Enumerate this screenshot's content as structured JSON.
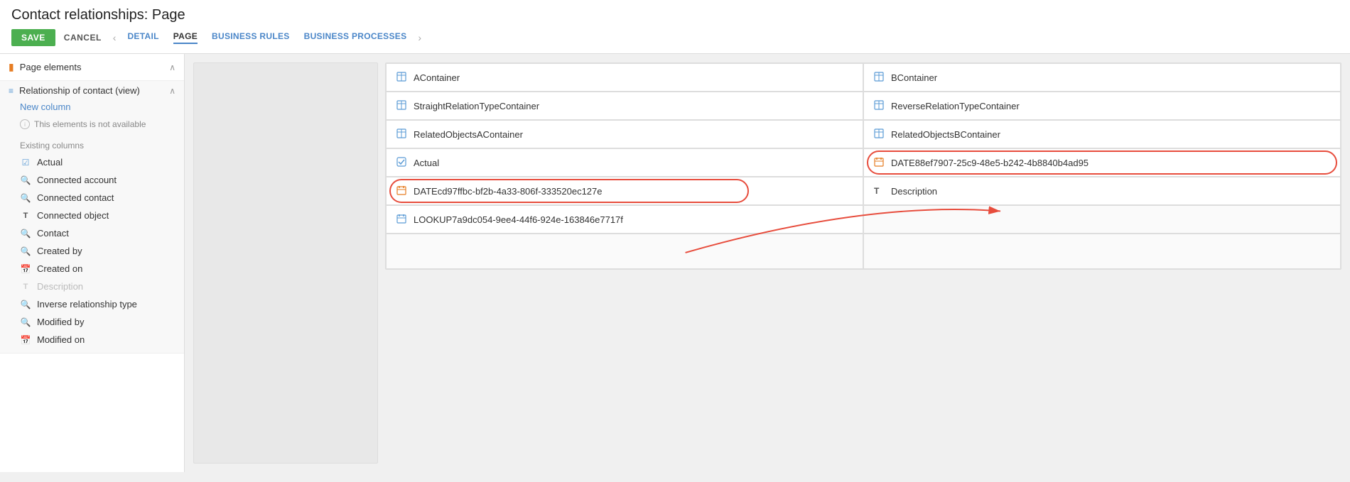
{
  "page": {
    "title": "Contact relationships: Page",
    "toolbar": {
      "save_label": "SAVE",
      "cancel_label": "CANCEL"
    },
    "nav": {
      "prev_arrow": "‹",
      "next_arrow": "›",
      "tabs": [
        {
          "label": "DETAIL",
          "active": false
        },
        {
          "label": "PAGE",
          "active": true
        },
        {
          "label": "BUSINESS RULES",
          "active": false
        },
        {
          "label": "BUSINESS PROCESSES",
          "active": false
        }
      ]
    }
  },
  "sidebar": {
    "section_title": "Page elements",
    "subsection_title": "Relationship of contact (view)",
    "new_column": "New column",
    "unavailable_text": "This elements is not available",
    "existing_columns_label": "Existing columns",
    "items": [
      {
        "label": "Actual",
        "icon": "check",
        "disabled": false
      },
      {
        "label": "Connected account",
        "icon": "search",
        "disabled": false
      },
      {
        "label": "Connected contact",
        "icon": "search",
        "disabled": false
      },
      {
        "label": "Connected object",
        "icon": "text",
        "disabled": false
      },
      {
        "label": "Contact",
        "icon": "search",
        "disabled": false
      },
      {
        "label": "Created by",
        "icon": "search",
        "disabled": false
      },
      {
        "label": "Created on",
        "icon": "calendar",
        "disabled": false
      },
      {
        "label": "Description",
        "icon": "text",
        "disabled": true
      },
      {
        "label": "Inverse relationship type",
        "icon": "search",
        "disabled": false
      },
      {
        "label": "Modified by",
        "icon": "search",
        "disabled": false
      },
      {
        "label": "Modified on",
        "icon": "calendar",
        "disabled": false
      }
    ]
  },
  "grid": {
    "cells": [
      [
        {
          "icon": "table",
          "label": "AContainer",
          "col": 0,
          "row": 0,
          "annotated": false
        },
        {
          "icon": "table",
          "label": "BContainer",
          "col": 1,
          "row": 0,
          "annotated": false
        }
      ],
      [
        {
          "icon": "table",
          "label": "StraightRelationTypeContainer",
          "col": 0,
          "row": 1,
          "annotated": false
        },
        {
          "icon": "table",
          "label": "ReverseRelationTypeContainer",
          "col": 1,
          "row": 1,
          "annotated": false
        }
      ],
      [
        {
          "icon": "table",
          "label": "RelatedObjectsAContainer",
          "col": 0,
          "row": 2,
          "annotated": false
        },
        {
          "icon": "table",
          "label": "RelatedObjectsBContainer",
          "col": 1,
          "row": 2,
          "annotated": false
        }
      ],
      [
        {
          "icon": "check",
          "label": "Actual",
          "col": 0,
          "row": 3,
          "annotated": false
        },
        {
          "icon": "date",
          "label": "DATE88ef7907-25c9-48e5-b242-4b8840b4ad95",
          "col": 1,
          "row": 3,
          "annotated": true
        }
      ],
      [
        {
          "icon": "date",
          "label": "DATEcd97ffbc-bf2b-4a33-806f-333520ec127e",
          "col": 0,
          "row": 4,
          "annotated": true
        },
        {
          "icon": "text",
          "label": "Description",
          "col": 1,
          "row": 4,
          "annotated": false
        }
      ],
      [
        {
          "icon": "lookup",
          "label": "LOOKUP7a9dc054-9ee4-44f6-924e-163846e7717f",
          "col": 0,
          "row": 5,
          "annotated": false
        },
        {
          "icon": "",
          "label": "",
          "col": 1,
          "row": 5,
          "annotated": false,
          "empty": true
        }
      ],
      [
        {
          "icon": "",
          "label": "",
          "col": 0,
          "row": 6,
          "annotated": false,
          "empty": true
        },
        {
          "icon": "",
          "label": "",
          "col": 1,
          "row": 6,
          "annotated": false,
          "empty": true
        }
      ]
    ]
  },
  "icons": {
    "check": "☑",
    "search": "🔍",
    "text": "T",
    "calendar": "📅",
    "table": "⊞",
    "date": "📋",
    "lookup": "📋"
  }
}
